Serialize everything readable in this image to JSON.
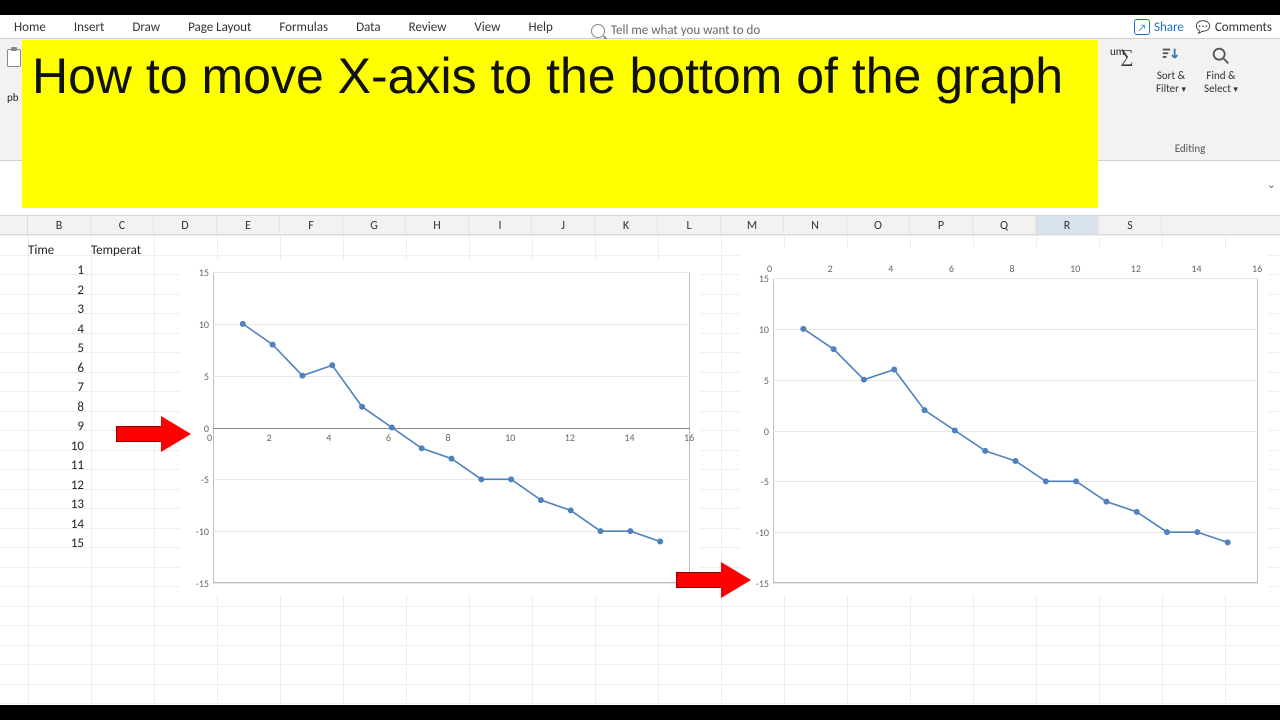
{
  "ribbon": {
    "tabs": [
      "Home",
      "Insert",
      "Draw",
      "Page Layout",
      "Formulas",
      "Data",
      "Review",
      "View",
      "Help"
    ],
    "search_placeholder": "Tell me what you want to do",
    "share": "Share",
    "comments": "Comments",
    "editing_group": "Editing",
    "autosum": "um",
    "sortfilter_l1": "Sort &",
    "sortfilter_l2": "Filter",
    "findselect_l1": "Find &",
    "findselect_l2": "Select",
    "clipboard_partial": "pb"
  },
  "overlay_title": "How to move X-axis to the bottom of the graph",
  "columns": [
    "B",
    "C",
    "D",
    "E",
    "F",
    "G",
    "H",
    "I",
    "J",
    "K",
    "L",
    "M",
    "N",
    "O",
    "P",
    "Q",
    "R",
    "S"
  ],
  "selected_column_index": 16,
  "table": {
    "headers": {
      "col_b": "Time",
      "col_c": "Temperat"
    },
    "time_values": [
      1,
      2,
      3,
      4,
      5,
      6,
      7,
      8,
      9,
      10,
      11,
      12,
      13,
      14,
      15
    ]
  },
  "chart_data": [
    {
      "id": "chart_left",
      "type": "line",
      "x": [
        1,
        2,
        3,
        4,
        5,
        6,
        7,
        8,
        9,
        10,
        11,
        12,
        13,
        14,
        15
      ],
      "values": [
        10,
        8,
        5,
        6,
        2,
        0,
        -2,
        -3,
        -5,
        -5,
        -7,
        -8,
        -10,
        -10,
        -11
      ],
      "xlim": [
        0,
        16
      ],
      "ylim": [
        -15,
        15
      ],
      "xticks": [
        0,
        2,
        4,
        6,
        8,
        10,
        12,
        14,
        16
      ],
      "yticks": [
        -15,
        -10,
        -5,
        0,
        5,
        10,
        15
      ],
      "x_axis_position": "y=0",
      "markers": true,
      "grid": "horizontal",
      "title": "",
      "xlabel": "",
      "ylabel": ""
    },
    {
      "id": "chart_right",
      "type": "line",
      "x": [
        1,
        2,
        3,
        4,
        5,
        6,
        7,
        8,
        9,
        10,
        11,
        12,
        13,
        14,
        15
      ],
      "values": [
        10,
        8,
        5,
        6,
        2,
        0,
        -2,
        -3,
        -5,
        -5,
        -7,
        -8,
        -10,
        -10,
        -11
      ],
      "xlim": [
        0,
        16
      ],
      "ylim": [
        -15,
        15
      ],
      "xticks": [
        0,
        2,
        4,
        6,
        8,
        10,
        12,
        14,
        16
      ],
      "yticks": [
        -15,
        -10,
        -5,
        0,
        5,
        10,
        15
      ],
      "x_axis_position": "top",
      "markers": true,
      "grid": "horizontal",
      "title": "",
      "xlabel": "",
      "ylabel": ""
    }
  ]
}
